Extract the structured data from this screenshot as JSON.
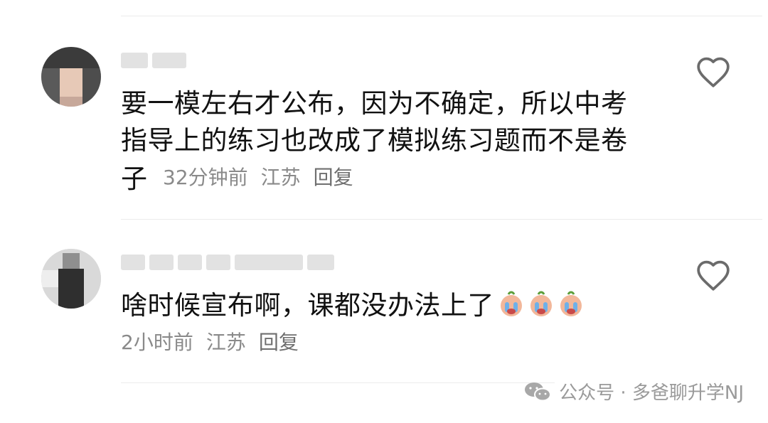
{
  "comments": [
    {
      "text_line1": "要一模左右才公布，因为不确定，所以中考",
      "text_line2": "指导上的练习也改成了模拟练习题而不是卷",
      "text_trail": "子",
      "time": "32分钟前",
      "location": "江苏",
      "reply_label": "回复"
    },
    {
      "text_line1": "啥时候宣布啊，课都没办法上了",
      "emoji_count": 3,
      "time": "2小时前",
      "location": "江苏",
      "reply_label": "回复"
    }
  ],
  "icons": {
    "like": "heart-outline-icon",
    "emoji": "crying-face-emoji",
    "brand": "wechat-icon"
  },
  "watermark": {
    "text": "公众号 · 多爸聊升学NJ"
  },
  "colors": {
    "text": "#111111",
    "meta": "#8a8a8a",
    "icon": "#6b6b6b"
  }
}
